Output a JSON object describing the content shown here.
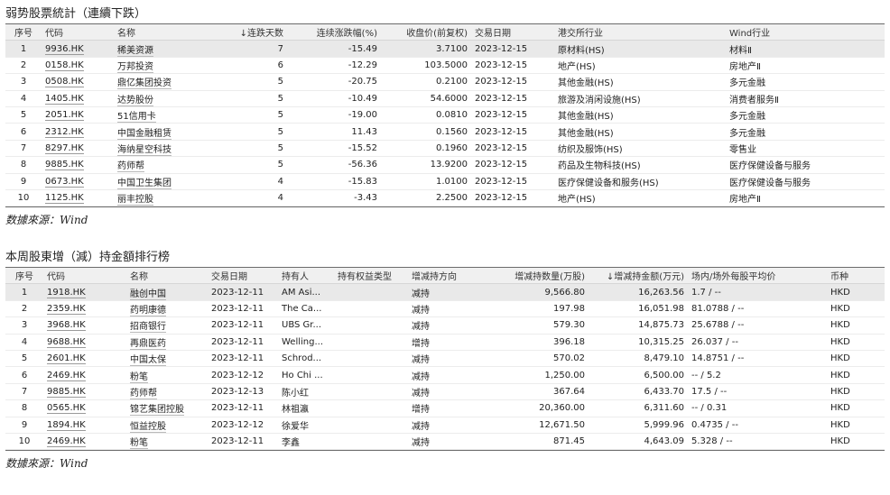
{
  "table1": {
    "title": "弱势股票統計（連續下跌）",
    "headers": [
      "序号",
      "代码",
      "名称",
      "↓连跌天数",
      "连续涨跌幅(%)",
      "收盘价(前复权)",
      "交易日期",
      "港交所行业",
      "Wind行业"
    ],
    "rows": [
      [
        "1",
        "9936.HK",
        "稀美资源",
        "7",
        "-15.49",
        "3.7100",
        "2023-12-15",
        "原材料(HS)",
        "材料Ⅱ"
      ],
      [
        "2",
        "0158.HK",
        "万邦投资",
        "6",
        "-12.29",
        "103.5000",
        "2023-12-15",
        "地产(HS)",
        "房地产Ⅱ"
      ],
      [
        "3",
        "0508.HK",
        "鼎亿集团投资",
        "5",
        "-20.75",
        "0.2100",
        "2023-12-15",
        "其他金融(HS)",
        "多元金融"
      ],
      [
        "4",
        "1405.HK",
        "达势股份",
        "5",
        "-10.49",
        "54.6000",
        "2023-12-15",
        "旅游及消闲设施(HS)",
        "消费者服务Ⅱ"
      ],
      [
        "5",
        "2051.HK",
        "51信用卡",
        "5",
        "-19.00",
        "0.0810",
        "2023-12-15",
        "其他金融(HS)",
        "多元金融"
      ],
      [
        "6",
        "2312.HK",
        "中国金融租赁",
        "5",
        "11.43",
        "0.1560",
        "2023-12-15",
        "其他金融(HS)",
        "多元金融"
      ],
      [
        "7",
        "8297.HK",
        "海纳星空科技",
        "5",
        "-15.52",
        "0.1960",
        "2023-12-15",
        "纺织及服饰(HS)",
        "零售业"
      ],
      [
        "8",
        "9885.HK",
        "药师帮",
        "5",
        "-56.36",
        "13.9200",
        "2023-12-15",
        "药品及生物科技(HS)",
        "医疗保健设备与服务"
      ],
      [
        "9",
        "0673.HK",
        "中国卫生集团",
        "4",
        "-15.83",
        "1.0100",
        "2023-12-15",
        "医疗保健设备和服务(HS)",
        "医疗保健设备与服务"
      ],
      [
        "10",
        "1125.HK",
        "丽丰控股",
        "4",
        "-3.43",
        "2.2500",
        "2023-12-15",
        "地产(HS)",
        "房地产Ⅱ"
      ]
    ],
    "source": "数據來源：Wind"
  },
  "table2": {
    "title": "本周股東增（減）持金額排行榜",
    "headers": [
      "序号",
      "代码",
      "名称",
      "交易日期",
      "持有人",
      "持有权益类型",
      "增减持方向",
      "增减持数量(万股)",
      "↓增减持金额(万元)",
      "场内/场外每股平均价",
      "币种"
    ],
    "rows": [
      [
        "1",
        "1918.HK",
        "融创中国",
        "2023-12-11",
        "AM Asi...",
        "",
        "减持",
        "9,566.80",
        "16,263.56",
        "1.7 / --",
        "HKD"
      ],
      [
        "2",
        "2359.HK",
        "药明康德",
        "2023-12-11",
        "The Ca...",
        "",
        "减持",
        "197.98",
        "16,051.98",
        "81.0788 / --",
        "HKD"
      ],
      [
        "3",
        "3968.HK",
        "招商银行",
        "2023-12-11",
        "UBS Gr...",
        "",
        "减持",
        "579.30",
        "14,875.73",
        "25.6788 / --",
        "HKD"
      ],
      [
        "4",
        "9688.HK",
        "再鼎医药",
        "2023-12-11",
        "Welling...",
        "",
        "增持",
        "396.18",
        "10,315.25",
        "26.037 / --",
        "HKD"
      ],
      [
        "5",
        "2601.HK",
        "中国太保",
        "2023-12-11",
        "Schrod...",
        "",
        "减持",
        "570.02",
        "8,479.10",
        "14.8751 / --",
        "HKD"
      ],
      [
        "6",
        "2469.HK",
        "粉笔",
        "2023-12-12",
        "Ho Chi ...",
        "",
        "减持",
        "1,250.00",
        "6,500.00",
        "-- / 5.2",
        "HKD"
      ],
      [
        "7",
        "9885.HK",
        "药师帮",
        "2023-12-13",
        "陈小红",
        "",
        "减持",
        "367.64",
        "6,433.70",
        "17.5 / --",
        "HKD"
      ],
      [
        "8",
        "0565.HK",
        "锦艺集团控股",
        "2023-12-11",
        "林祖瀛",
        "",
        "增持",
        "20,360.00",
        "6,311.60",
        "-- / 0.31",
        "HKD"
      ],
      [
        "9",
        "1894.HK",
        "恒益控股",
        "2023-12-12",
        "徐爱华",
        "",
        "减持",
        "12,671.50",
        "5,999.96",
        "0.4735 / --",
        "HKD"
      ],
      [
        "10",
        "2469.HK",
        "粉笔",
        "2023-12-11",
        "李鑫",
        "",
        "减持",
        "871.45",
        "4,643.09",
        "5.328 / --",
        "HKD"
      ]
    ],
    "source": "数據來源：Wind"
  }
}
